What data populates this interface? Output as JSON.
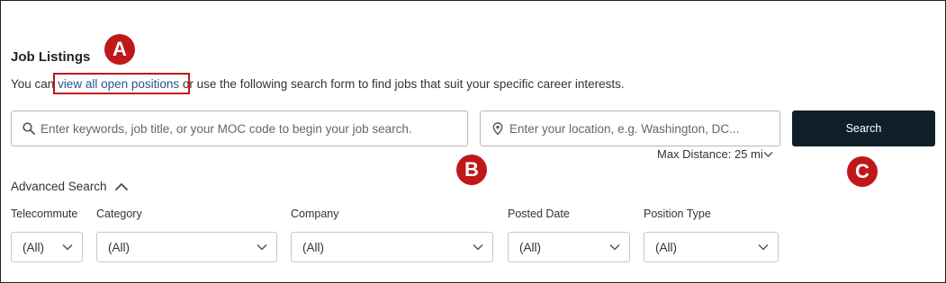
{
  "section": {
    "title": "Job Listings",
    "intro_before": "You can ",
    "intro_link": "view all open positions",
    "intro_after": " or use the following search form to find jobs that suit your specific career interests."
  },
  "search": {
    "keywords_placeholder": "Enter keywords, job title, or your MOC code to begin your job search.",
    "location_placeholder": "Enter your location, e.g. Washington, DC...",
    "button_label": "Search",
    "max_distance": "Max Distance: 25 mi"
  },
  "advanced": {
    "label": "Advanced Search",
    "filters": [
      {
        "label": "Telecommute",
        "value": "(All)"
      },
      {
        "label": "Category",
        "value": "(All)"
      },
      {
        "label": "Company",
        "value": "(All)"
      },
      {
        "label": "Posted Date",
        "value": "(All)"
      },
      {
        "label": "Position Type",
        "value": "(All)"
      }
    ]
  },
  "annotations": {
    "a": "A",
    "b": "B",
    "c": "C",
    "color": "#c01818"
  },
  "colors": {
    "link": "#1f5a8c",
    "button_bg": "#0f1f2a"
  }
}
